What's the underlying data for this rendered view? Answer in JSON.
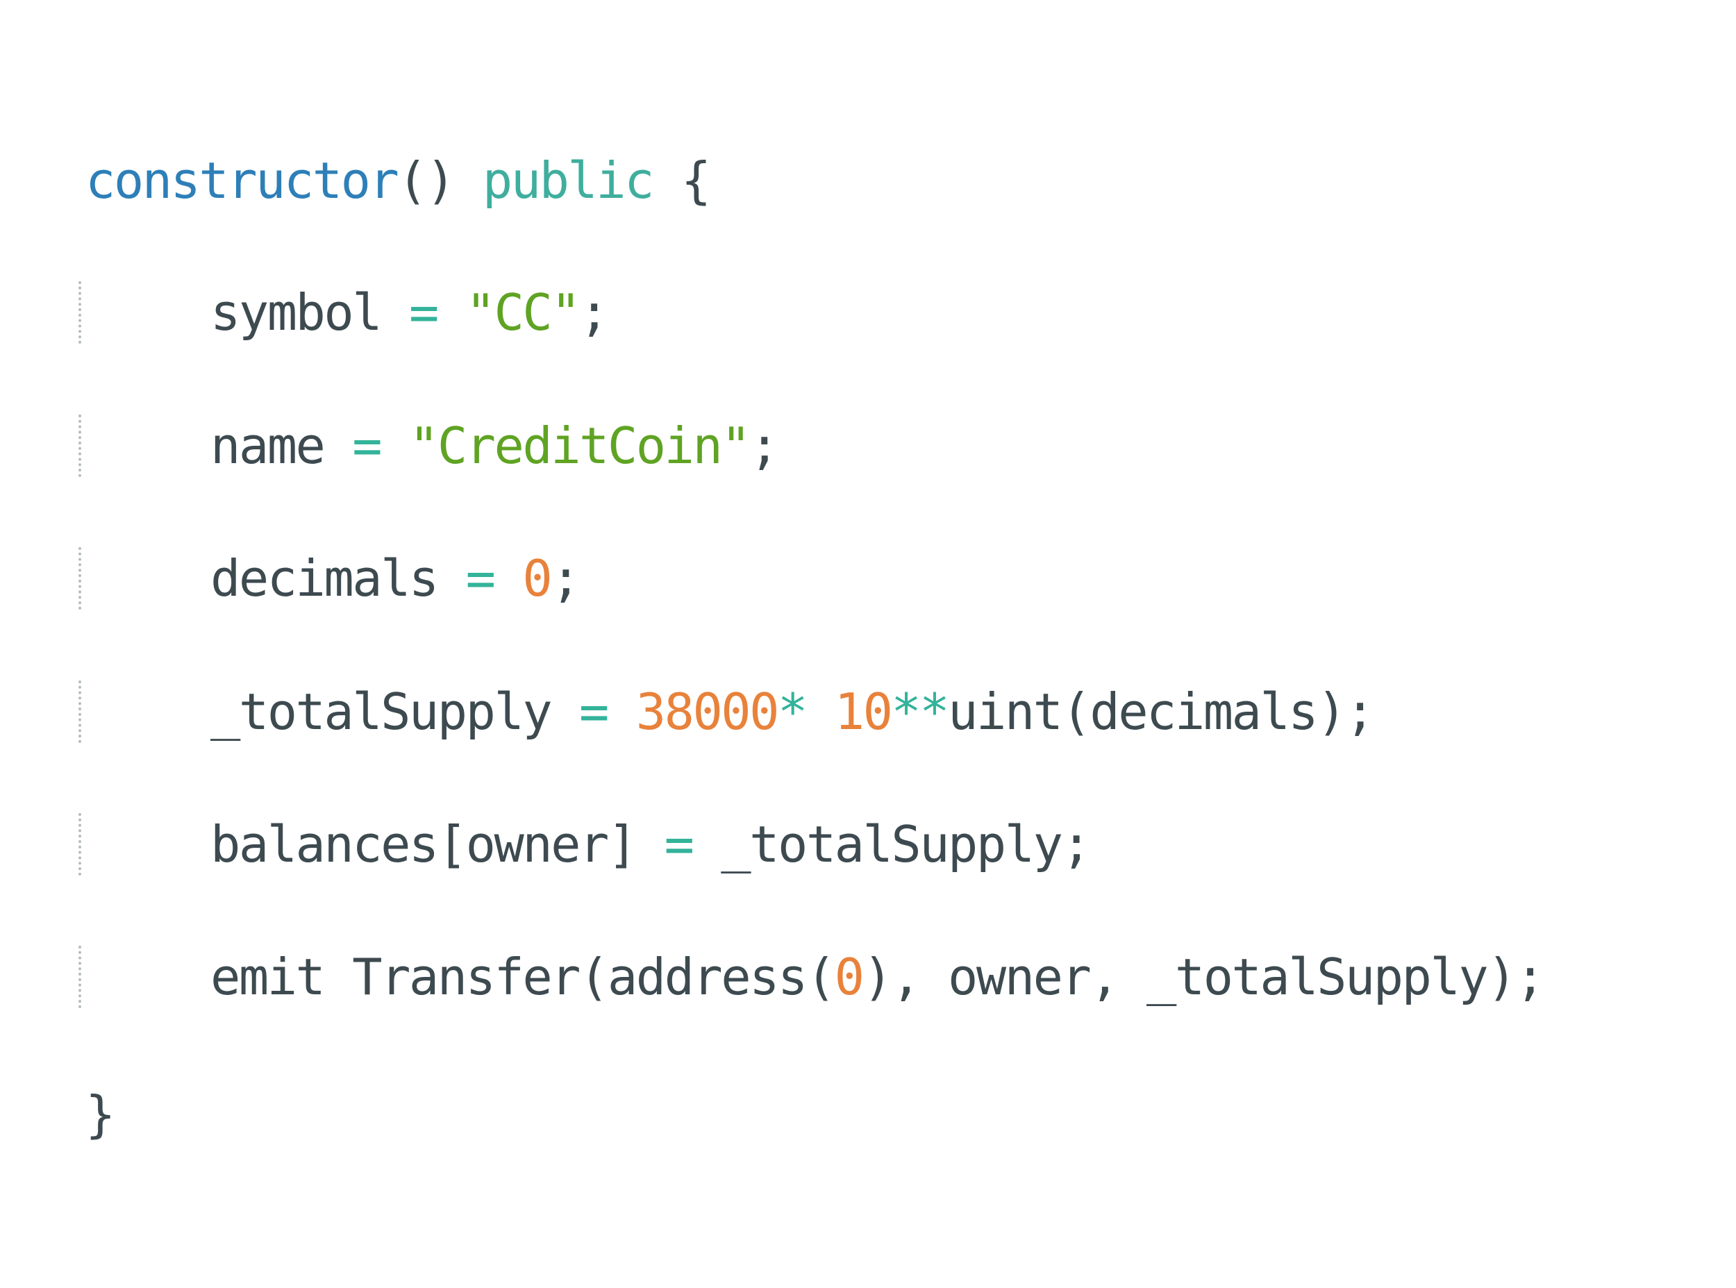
{
  "colors": {
    "background": "#ffffff",
    "plain": "#3d4a50",
    "keyword": "#2e7fb8",
    "modifier": "#3fae9e",
    "operator": "#33b39a",
    "string": "#5fa323",
    "number": "#e8823b",
    "indent_guide": "#b3bbc0"
  },
  "lines": [
    {
      "tokens": [
        {
          "text": "constructor",
          "kind": "keyword"
        },
        {
          "text": "() ",
          "kind": "plain"
        },
        {
          "text": "public",
          "kind": "modifier"
        },
        {
          "text": " {",
          "kind": "plain"
        }
      ]
    },
    {
      "tokens": [
        {
          "text": "symbol ",
          "kind": "plain"
        },
        {
          "text": "=",
          "kind": "operator"
        },
        {
          "text": " ",
          "kind": "plain"
        },
        {
          "text": "\"CC\"",
          "kind": "string"
        },
        {
          "text": ";",
          "kind": "plain"
        }
      ]
    },
    {
      "tokens": [
        {
          "text": "name ",
          "kind": "plain"
        },
        {
          "text": "=",
          "kind": "operator"
        },
        {
          "text": " ",
          "kind": "plain"
        },
        {
          "text": "\"CreditCoin\"",
          "kind": "string"
        },
        {
          "text": ";",
          "kind": "plain"
        }
      ]
    },
    {
      "tokens": [
        {
          "text": "decimals ",
          "kind": "plain"
        },
        {
          "text": "=",
          "kind": "operator"
        },
        {
          "text": " ",
          "kind": "plain"
        },
        {
          "text": "0",
          "kind": "number"
        },
        {
          "text": ";",
          "kind": "plain"
        }
      ]
    },
    {
      "tokens": [
        {
          "text": "_totalSupply ",
          "kind": "plain"
        },
        {
          "text": "=",
          "kind": "operator"
        },
        {
          "text": " ",
          "kind": "plain"
        },
        {
          "text": "38000",
          "kind": "number"
        },
        {
          "text": "*",
          "kind": "operator"
        },
        {
          "text": " ",
          "kind": "plain"
        },
        {
          "text": "10",
          "kind": "number"
        },
        {
          "text": "**",
          "kind": "operator"
        },
        {
          "text": "uint(decimals);",
          "kind": "plain"
        }
      ]
    },
    {
      "tokens": [
        {
          "text": "balances[owner] ",
          "kind": "plain"
        },
        {
          "text": "=",
          "kind": "operator"
        },
        {
          "text": " _totalSupply;",
          "kind": "plain"
        }
      ]
    },
    {
      "tokens": [
        {
          "text": "emit Transfer(address(",
          "kind": "plain"
        },
        {
          "text": "0",
          "kind": "number"
        },
        {
          "text": "), owner, _totalSupply);",
          "kind": "plain"
        }
      ]
    },
    {
      "tokens": [
        {
          "text": "}",
          "kind": "plain"
        }
      ]
    }
  ]
}
